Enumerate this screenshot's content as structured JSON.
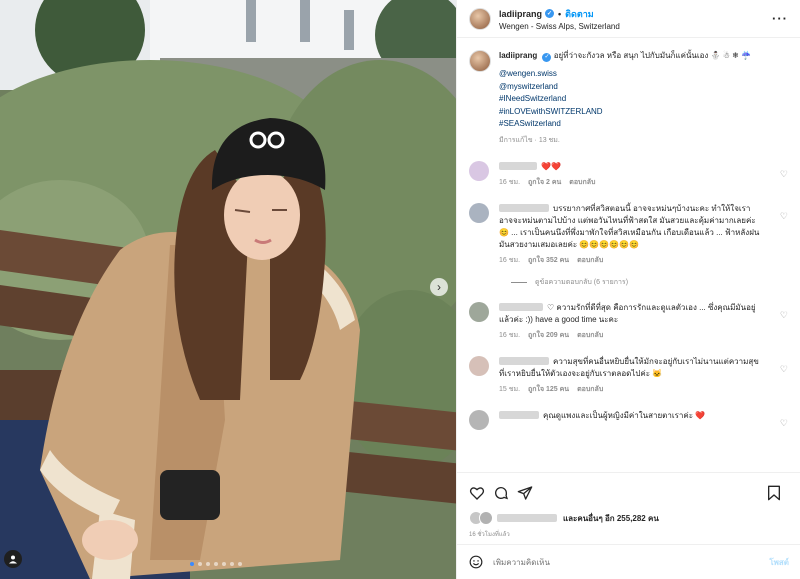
{
  "post": {
    "username": "ladiiprang",
    "follow_label": "ติดตาม",
    "location": "Wengen - Swiss Alps, Switzerland",
    "more_icon": "more-icon",
    "caption": {
      "username": "ladiiprang",
      "text": "อยู่ที่ว่าจะกังวล หรือ สนุก ไปกับมันก็แค่นั้นเอง ⛄ ☃ ❄ ☔",
      "tags": [
        "@wengen.swiss",
        "@myswitzerland",
        "#INeedSwitzerland",
        "#inLOVEwithSWITZERLAND",
        "#SEASwitzerland"
      ],
      "meta": "มีการแก้ไข · 13 ชม."
    }
  },
  "comments": [
    {
      "text": "❤️❤️",
      "time": "16 ชม.",
      "likes": "ถูกใจ 2 คน",
      "reply": "ตอบกลับ",
      "avatar_color": "#d9c7e3"
    },
    {
      "text": "บรรยากาศที่สวิสตอนนี้ อาจจะหม่นๆบ้างนะคะ ทำให้ใจเราอาจจะหม่นตามไปบ้าง แต่พอวันไหนที่ฟ้าสดใส มันสวยและคุ้มค่ามากเลยค่ะ 😊 ... เราเป็นคนนึงที่พึ่งมาพักใจที่สวิสเหมือนกัน เกือบเดือนแล้ว ... ฟ้าหลังฝน มันสวยงามเสมอเลยค่ะ 😊😊😊😊😊😊",
      "time": "16 ชม.",
      "likes": "ถูกใจ 352 คน",
      "reply": "ตอบกลับ",
      "avatar_color": "#aab3c0",
      "view_replies": "ดูข้อความตอบกลับ (6 รายการ)"
    },
    {
      "text": "♡ ความรักที่ดีที่สุด คือการรักและดูแลตัวเอง ... ซึ่งคุณมีมันอยู่แล้วค่ะ :)) have a good time นะคะ",
      "time": "16 ชม.",
      "likes": "ถูกใจ 209 คน",
      "reply": "ตอบกลับ",
      "avatar_color": "#9ea79a"
    },
    {
      "text": "ความสุขที่คนอื่นหยิบยื่นให้มักจะอยู่กับเราไม่นานแต่ความสุขที่เราหยิบยื่นให้ตัวเองจะอยู่กับเราตลอดไปค่ะ 🐱",
      "time": "15 ชม.",
      "likes": "ถูกใจ 125 คน",
      "reply": "ตอบกลับ",
      "avatar_color": "#d6c0b8"
    },
    {
      "text": "คุณดูแพงและเป็นผู้หญิงมีค่าในสายตาเราค่ะ ❤️",
      "time": "",
      "likes": "",
      "reply": "",
      "avatar_color": "#b5b5b5"
    }
  ],
  "likes_summary": {
    "text": "และคนอื่นๆ อีก 255,282 คน",
    "time_ago": "16 ชั่วโมงที่แล้ว"
  },
  "add_comment": {
    "placeholder": "เพิ่มความคิดเห็น",
    "post_label": "โพสต์"
  },
  "colors": {
    "link": "#00376b",
    "follow": "#0095f6",
    "heart": "#ed4956"
  }
}
